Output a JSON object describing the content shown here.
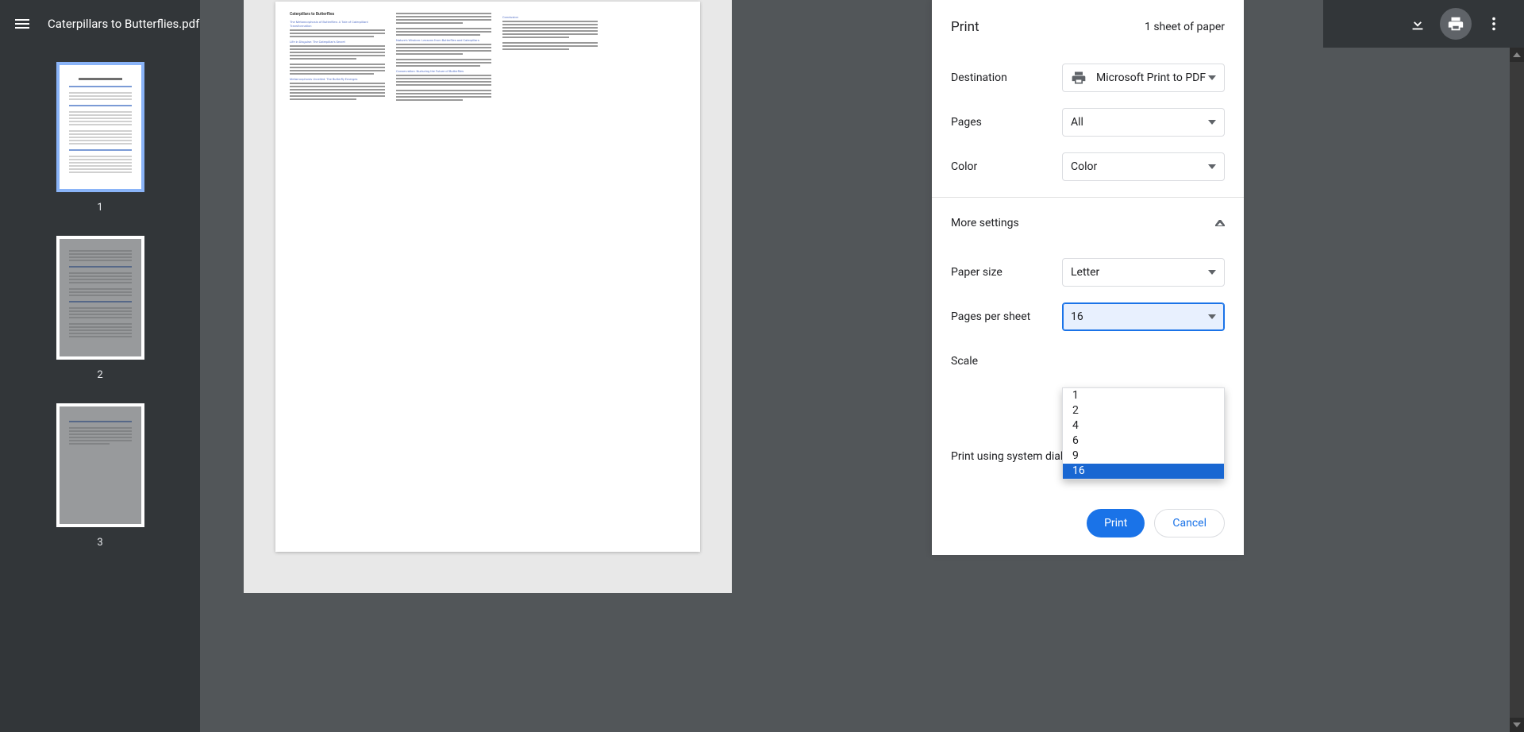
{
  "toolbar": {
    "doc_title": "Caterpillars to Butterflies.pdf"
  },
  "thumbnails": {
    "items": [
      {
        "num": "1"
      },
      {
        "num": "2"
      },
      {
        "num": "3"
      }
    ]
  },
  "preview": {
    "doc_title": "Caterpillars to Butterflies",
    "headings": {
      "h1": "The Metamorphosis of Butterflies: A Tale of Caterpillars' Transformation",
      "h2": "Life in Disguise: The Caterpillar's Secret",
      "h3": "Metamorphosis Unveiled: The Butterfly Emerges",
      "h4": "Nature's Wisdom: Lessons from Butterflies and Caterpillars",
      "h5": "Conservation: Nurturing the Future of Butterflies",
      "h6": "Conclusion"
    }
  },
  "print": {
    "title": "Print",
    "sheets": "1 sheet of paper",
    "labels": {
      "destination": "Destination",
      "pages": "Pages",
      "color": "Color",
      "more": "More settings",
      "paper_size": "Paper size",
      "pages_per_sheet": "Pages per sheet",
      "scale": "Scale",
      "system_dialog": "Print using system dialog... (Ctrl+Shift+P)"
    },
    "values": {
      "destination": "Microsoft Print to PDF",
      "pages": "All",
      "color": "Color",
      "paper_size": "Letter",
      "pages_per_sheet": "16"
    },
    "pages_per_sheet_options": [
      "1",
      "2",
      "4",
      "6",
      "9",
      "16"
    ],
    "buttons": {
      "print": "Print",
      "cancel": "Cancel"
    }
  },
  "colors": {
    "accent": "#1a73e8",
    "dropdown_selected": "#1967d2",
    "thumb_selected": "#8ab4f8",
    "toolbar_bg": "#323639"
  }
}
